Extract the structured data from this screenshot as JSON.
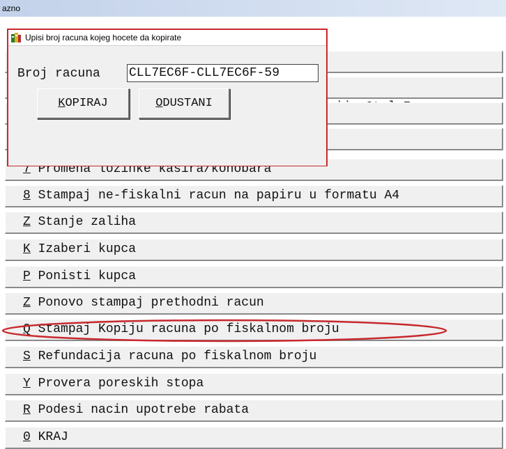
{
  "window": {
    "title_fragment": "azno"
  },
  "menu": {
    "items": [
      {
        "hotkey": "",
        "text": "",
        "visible_text": ""
      },
      {
        "hotkey": "",
        "text": "elariju Ctrl+F",
        "visible_text": "elariju Ctrl+F"
      },
      {
        "hotkey": "",
        "text": "",
        "visible_text": ""
      },
      {
        "hotkey": "",
        "text": "",
        "visible_text": ""
      },
      {
        "hotkey": "7",
        "text": " Promena lozinke kasira/konobara"
      },
      {
        "hotkey": "8",
        "text": " Stampaj ne-fiskalni racun na papiru u formatu A4"
      },
      {
        "hotkey": "Z",
        "text": " Stanje zaliha"
      },
      {
        "hotkey": "K",
        "text": " Izaberi kupca"
      },
      {
        "hotkey": "P",
        "text": " Ponisti kupca"
      },
      {
        "hotkey": "Z",
        "text": " Ponovo stampaj prethodni racun"
      },
      {
        "hotkey": "Q",
        "text": " Stampaj Kopiju racuna po fiskalnom broju"
      },
      {
        "hotkey": "S",
        "text": " Refundacija racuna po fiskalnom broju"
      },
      {
        "hotkey": "Y",
        "text": " Provera poreskih stopa"
      },
      {
        "hotkey": "R",
        "text": " Podesi nacin upotrebe rabata"
      },
      {
        "hotkey": "0",
        "text": " KRAJ"
      }
    ]
  },
  "dialog": {
    "title": "Upisi broj racuna kojeg hocete da kopirate",
    "field_label": "Broj racuna",
    "field_value": "CLL7EC6F-CLL7EC6F-59",
    "kopiraj": {
      "hotkey": "K",
      "rest": "OPIRAJ"
    },
    "odustani": {
      "hotkey": "O",
      "rest": "DUSTANI"
    }
  },
  "colors": {
    "highlight": "#c8282d",
    "dialog_border": "#c8282d"
  }
}
